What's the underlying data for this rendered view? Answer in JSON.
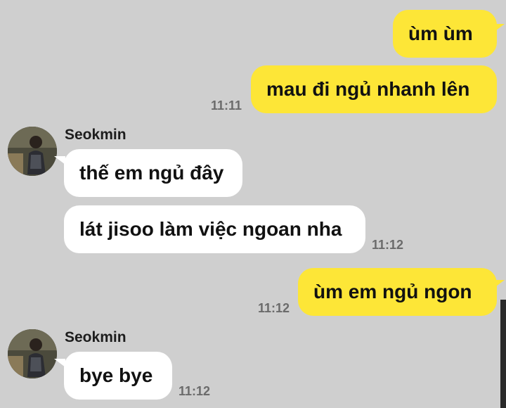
{
  "messages": [
    {
      "text": "ùm ùm",
      "time": ""
    },
    {
      "text": "mau đi ngủ nhanh lên",
      "time": "11:11"
    },
    {
      "sender": "Seokmin",
      "text": "thế em ngủ đây",
      "time": ""
    },
    {
      "text": "lát jisoo làm việc ngoan nha",
      "time": "11:12"
    },
    {
      "text": "ùm em ngủ ngon",
      "time": "11:12"
    },
    {
      "sender": "Seokmin",
      "text": "bye bye",
      "time": "11:12"
    }
  ],
  "colors": {
    "background": "#cfcfcf",
    "outgoing_bubble": "#fde637",
    "incoming_bubble": "#ffffff",
    "timestamp": "#6b6b6b"
  },
  "icons": {
    "avatar": "user-avatar-photo"
  }
}
